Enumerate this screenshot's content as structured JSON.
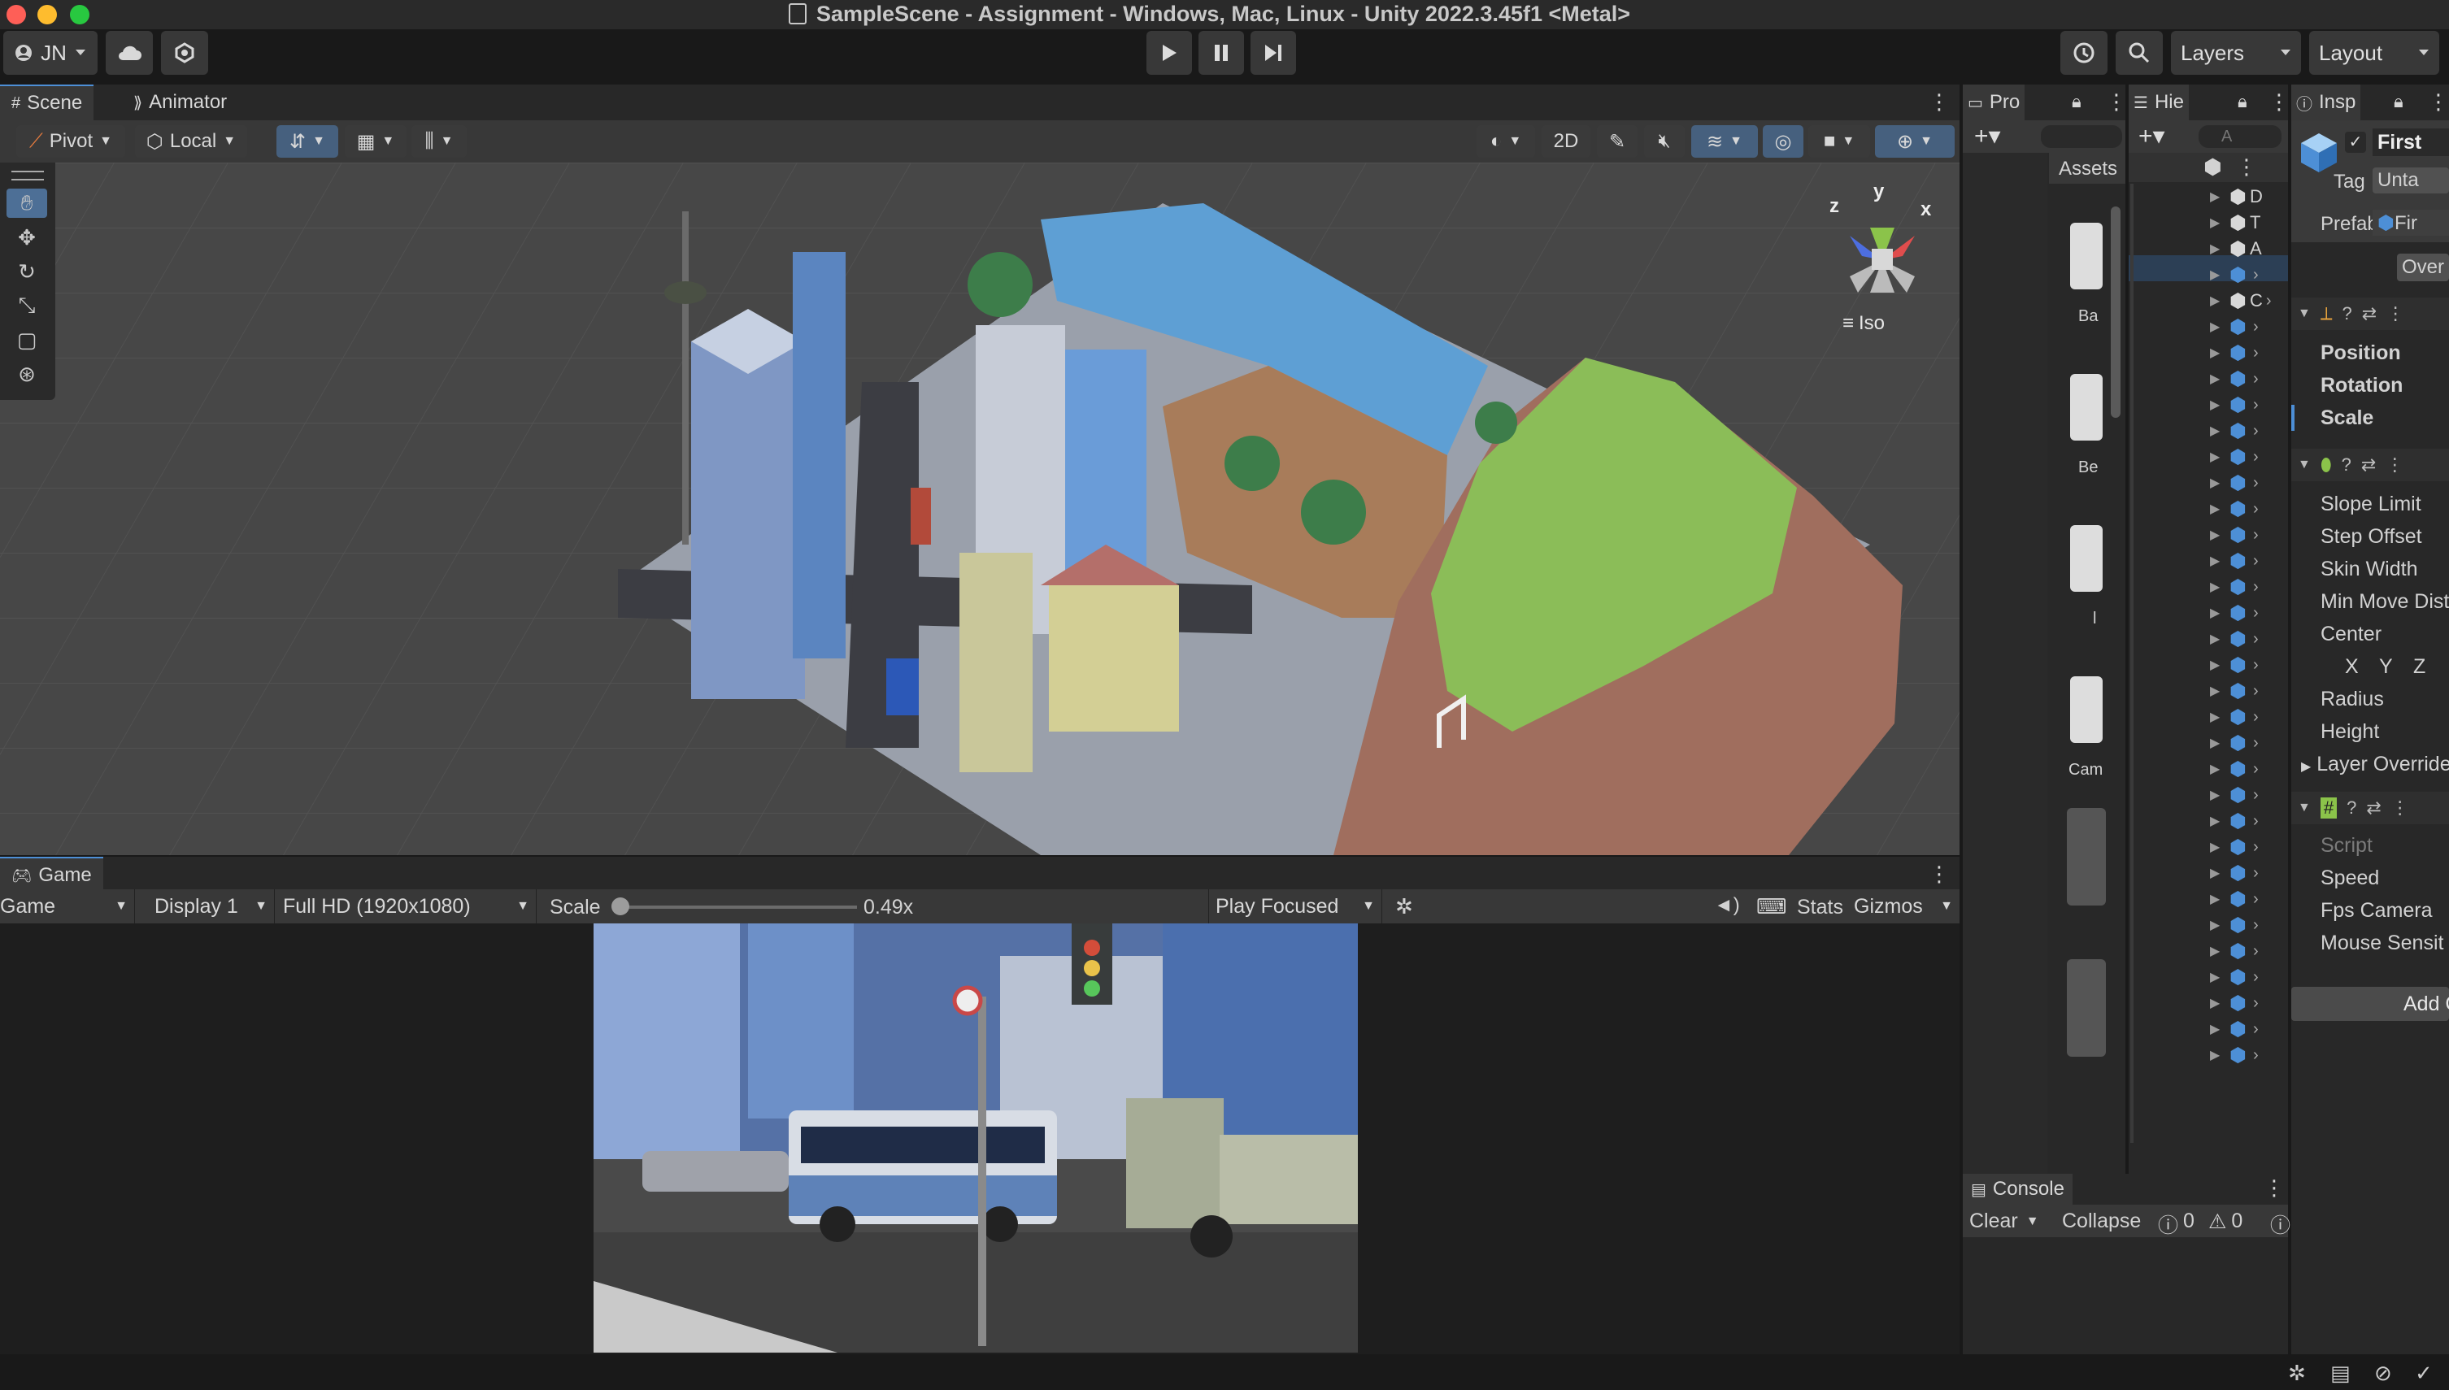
{
  "window": {
    "title": "SampleScene - Assignment - Windows, Mac, Linux - Unity 2022.3.45f1 <Metal>"
  },
  "toolbar": {
    "account_label": "JN",
    "layers_label": "Layers",
    "layout_label": "Layout",
    "icons": [
      "account-icon",
      "cloud-icon",
      "collab-icon",
      "play-icon",
      "pause-icon",
      "step-icon",
      "history-icon",
      "search-icon"
    ]
  },
  "scene_panel": {
    "tabs": [
      {
        "label": "Scene"
      },
      {
        "label": "Animator"
      }
    ],
    "pivot_label": "Pivot",
    "local_label": "Local",
    "mode_2d_label": "2D",
    "projection_label": "Iso",
    "gizmo_axes": {
      "x": "x",
      "y": "y",
      "z": "z"
    }
  },
  "game_panel": {
    "tab_label": "Game",
    "game_dropdown": "Game",
    "display_dropdown": "Display 1",
    "resolution_dropdown": "Full HD (1920x1080)",
    "scale_label": "Scale",
    "scale_value_label": "0.49x",
    "scale_value": 0.49,
    "play_mode_dropdown": "Play Focused",
    "stats_label": "Stats",
    "gizmos_label": "Gizmos"
  },
  "project_panel": {
    "tab_label": "Pro",
    "breadcrumb": "Assets",
    "items": [
      {
        "label": "Ba"
      },
      {
        "label": "Be"
      },
      {
        "label": "l"
      },
      {
        "label": "Cam"
      }
    ]
  },
  "hierarchy_panel": {
    "tab_label": "Hie",
    "search_placeholder": "A",
    "rows": [
      "D",
      "T",
      "A",
      "",
      "C"
    ]
  },
  "inspector_panel": {
    "tab_label": "Insp",
    "object_name": "First",
    "tag_label": "Tag",
    "tag_value": "Unta",
    "prefab_label": "Prefab",
    "prefab_value": "Fir",
    "overrides_label": "Over",
    "transform_fields": [
      "Position",
      "Rotation",
      "Scale"
    ],
    "controller_fields": [
      "Slope Limit",
      "Step Offset",
      "Skin Width",
      "Min Move Dist",
      "Center",
      "Radius",
      "Height",
      "Layer Override"
    ],
    "center_axes": [
      "X",
      "Y",
      "Z"
    ],
    "script_field": "Script",
    "script_fields": [
      "Speed",
      "Fps Camera",
      "Mouse Sensit"
    ],
    "add_component_label": "Add C"
  },
  "console_panel": {
    "tab_label": "Console",
    "clear_label": "Clear",
    "collapse_label": "Collapse",
    "error_count": "0",
    "warning_count": "0"
  },
  "colors": {
    "accent_blue": "#4d8fd6",
    "toolbar_bg": "#191919",
    "panel_bg": "#282828",
    "scene_bg": "#474747"
  }
}
